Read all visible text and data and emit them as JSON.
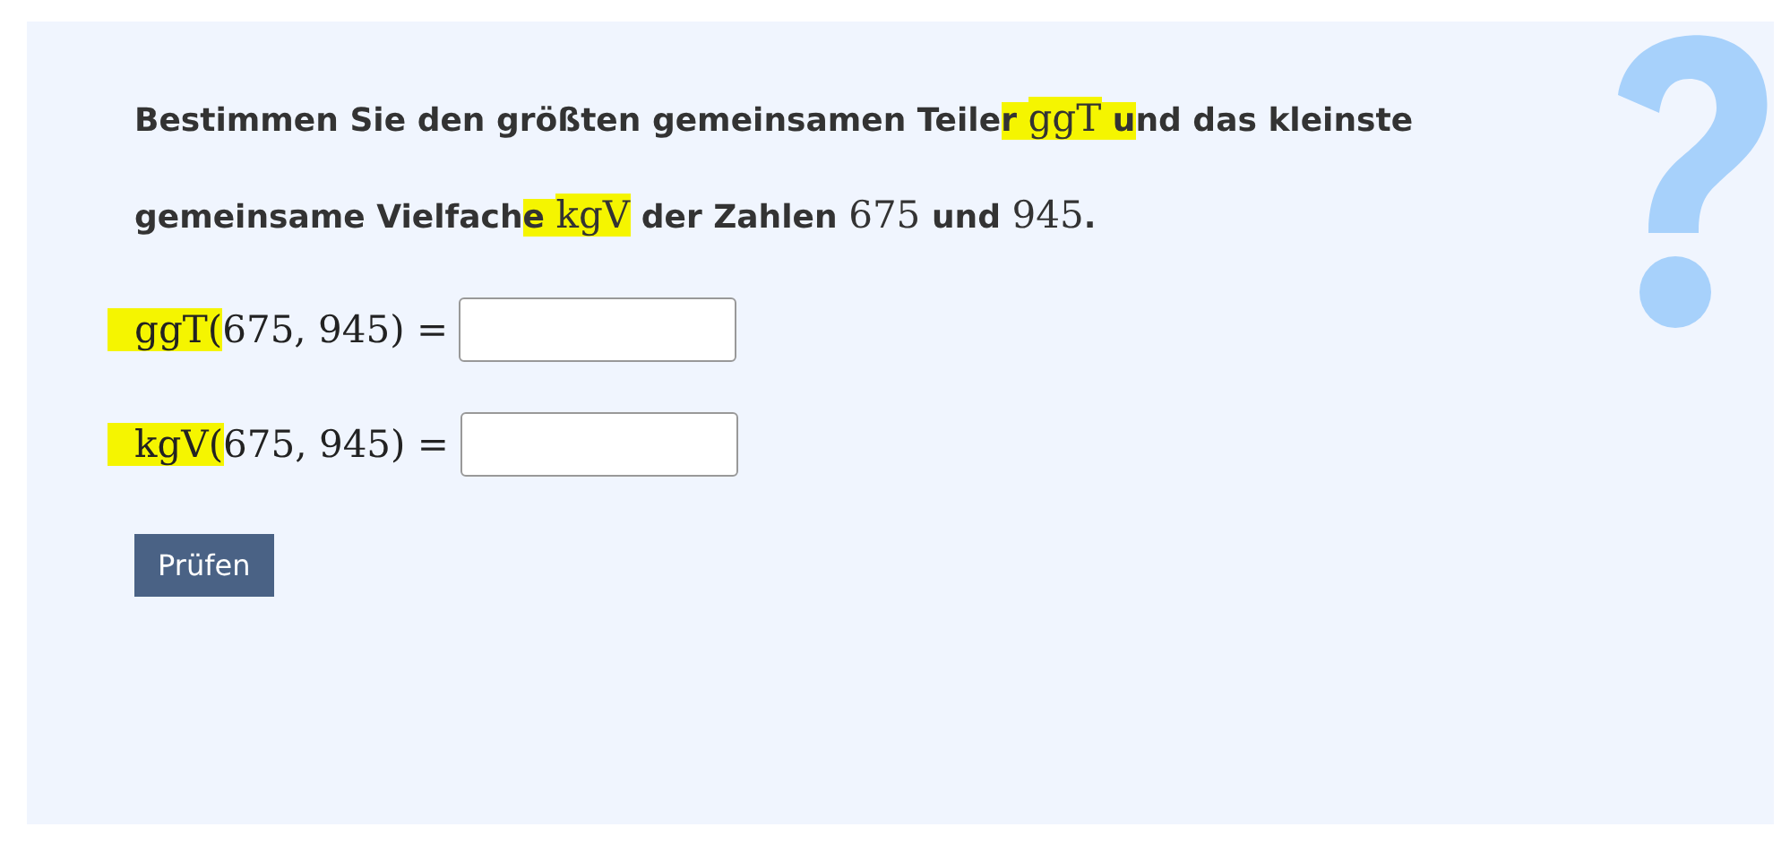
{
  "question": [
    {
      "text": "Bestimmen Sie den größten gemeinsamen Teile",
      "math": false,
      "highlighted": false
    },
    {
      "text": "r ",
      "math": false,
      "highlighted": true
    },
    {
      "text": "ggT",
      "math": true,
      "highlighted": true
    },
    {
      "text": " u",
      "math": false,
      "highlighted": true
    },
    {
      "text": "nd das kleinste gemeinsame Vielfach",
      "math": false,
      "highlighted": false
    },
    {
      "text": "e ",
      "math": false,
      "highlighted": true
    },
    {
      "text": "kgV",
      "math": true,
      "highlighted": true
    },
    {
      "text": " der Zahlen ",
      "math": false,
      "highlighted": false
    },
    {
      "text": "675",
      "math": true,
      "highlighted": false
    },
    {
      "text": " und ",
      "math": false,
      "highlighted": false
    },
    {
      "text": "945",
      "math": true,
      "highlighted": false
    },
    {
      "text": ".",
      "math": false,
      "highlighted": false
    }
  ],
  "equations": [
    {
      "parts": [
        {
          "text": "ggT(",
          "highlighted": true
        },
        {
          "text": "675, 945) =",
          "highlighted": false
        }
      ]
    },
    {
      "parts": [
        {
          "text": "kgV(",
          "highlighted": true
        },
        {
          "text": "675, 945) =",
          "highlighted": false
        }
      ]
    }
  ],
  "button": "Prüfen"
}
